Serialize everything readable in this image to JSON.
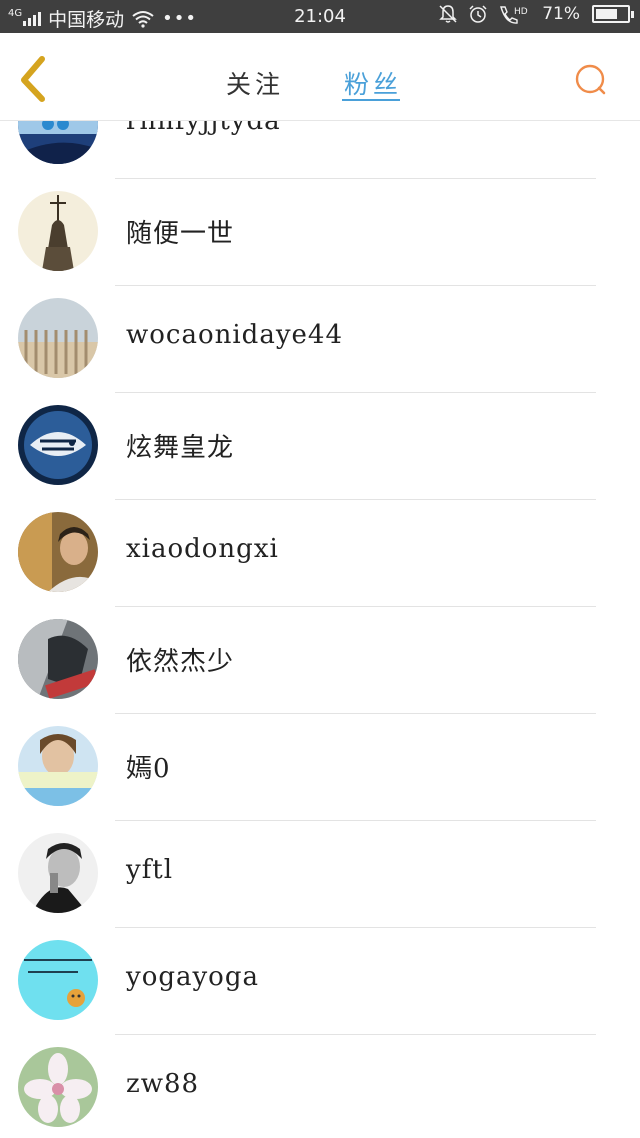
{
  "status_bar": {
    "network": "4G",
    "carrier": "中国移动",
    "dots": "•••",
    "time": "21:04",
    "hd": "HD",
    "battery_text": "71%",
    "battery_level": 0.71
  },
  "header": {
    "tab_follow": "关注",
    "tab_fans": "粉丝",
    "accent_color": "#4aa0d9",
    "back_color": "#d5a41f",
    "search_color": "#f08c4a"
  },
  "users": [
    {
      "name": "rhnfyjjtyda"
    },
    {
      "name": "随便一世"
    },
    {
      "name": "wocaonidaye44"
    },
    {
      "name": "炫舞皇龙"
    },
    {
      "name": "xiaodongxi"
    },
    {
      "name": "依然杰少"
    },
    {
      "name": "嫣0"
    },
    {
      "name": "yftl"
    },
    {
      "name": "yogayoga"
    },
    {
      "name": "zw88"
    }
  ]
}
